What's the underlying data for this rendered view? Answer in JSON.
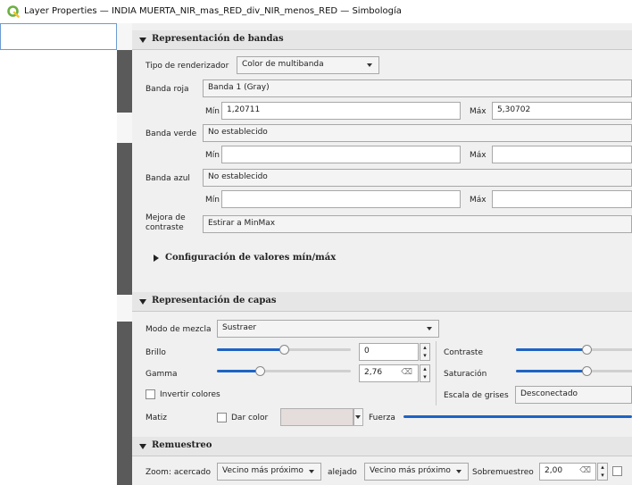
{
  "window": {
    "title": "Layer Properties — INDIA MUERTA_NIR_mas_RED_div_NIR_menos_RED — Simbología"
  },
  "band_rendering": {
    "title": "Representación de bandas",
    "renderer_label": "Tipo de renderizador",
    "renderer_value": "Color de multibanda",
    "red_label": "Banda roja",
    "red_value": "Banda 1 (Gray)",
    "red_min_label": "Mín",
    "red_min": "1,20711",
    "red_max_label": "Máx",
    "red_max": "5,30702",
    "green_label": "Banda verde",
    "green_value": "No establecido",
    "green_min_label": "Mín",
    "green_min": "",
    "green_max_label": "Máx",
    "green_max": "",
    "blue_label": "Banda azul",
    "blue_value": "No establecido",
    "blue_min_label": "Mín",
    "blue_min": "",
    "blue_max_label": "Máx",
    "blue_max": "",
    "contrast_label_1": "Mejora de",
    "contrast_label_2": "contraste",
    "contrast_value": "Estirar a MinMax",
    "minmax_config": "Configuración de valores mín/máx"
  },
  "layer_rendering": {
    "title": "Representación de capas",
    "blend_label": "Modo de mezcla",
    "blend_value": "Sustraer",
    "brightness_label": "Brillo",
    "brightness_value": "0",
    "brightness_level": 0.5,
    "contrast_label": "Contraste",
    "contrast_level": 0.5,
    "gamma_label": "Gamma",
    "gamma_value": "2,76",
    "gamma_level": 0.32,
    "saturation_label": "Saturación",
    "saturation_level": 0.5,
    "invert_label": "Invertir colores",
    "grayscale_label": "Escala de grises",
    "grayscale_value": "Desconectado",
    "hue_label": "Matiz",
    "colorize_label": "Dar color",
    "strength_label": "Fuerza"
  },
  "resampling": {
    "title": "Remuestreo",
    "zoom_in_label": "Zoom: acercado",
    "zoom_in_value": "Vecino más próximo",
    "zoom_out_label": "alejado",
    "zoom_out_value": "Vecino más próximo",
    "oversampling_label": "Sobremuestreo",
    "oversampling_value": "2,00"
  },
  "colors": {
    "accent": "#1d63c4",
    "qgis_green": "#6bb043"
  }
}
